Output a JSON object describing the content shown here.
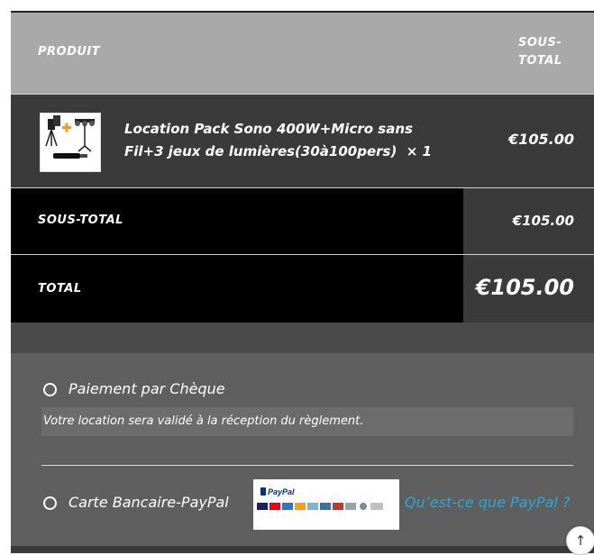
{
  "table": {
    "header": {
      "product": "PRODUIT",
      "subtotal": "SOUS-TOTAL"
    },
    "item": {
      "name": "Location Pack Sono 400W+Micro sans Fil+3 jeux de lumières(30à100pers)",
      "quantity": "× 1",
      "price": "€105.00",
      "thumbnail_icon": "sound-pack-thumbnail"
    },
    "subtotal": {
      "label": "SOUS-TOTAL",
      "value": "€105.00"
    },
    "total": {
      "label": "TOTAL",
      "value": "€105.00"
    }
  },
  "payment": {
    "options": [
      {
        "label": "Paiement par Chèque",
        "description": "Votre location sera validé à la réception du règlement."
      },
      {
        "label": "Carte Bancaire-PayPal",
        "link": "Qu’est-ce que PayPal ?",
        "logo_text": "PayPal"
      }
    ]
  },
  "colors": {
    "header_bg": "#a9a9a9",
    "row_bg": "#3a3a3a",
    "total_bg": "#000000",
    "payment_bg": "#5f5f5f",
    "link": "#2aa8d8"
  }
}
